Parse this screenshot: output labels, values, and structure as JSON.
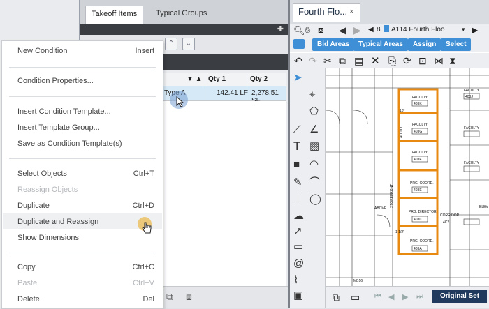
{
  "left_panel": {
    "tabs": [
      {
        "label": "Takeoff Items"
      },
      {
        "label": "Typical Groups"
      }
    ],
    "pin_icon": "pin-icon",
    "grid": {
      "columns": [
        "Qty 1",
        "Qty 2"
      ],
      "row": {
        "name": "Type A",
        "qty1": "142.41 LF",
        "qty2": "2,278.51 SF"
      }
    }
  },
  "context_menu": {
    "items": [
      {
        "label": "New Condition",
        "shortcut": "Insert",
        "enabled": true
      },
      {
        "label": "Condition Properties...",
        "shortcut": "",
        "enabled": true
      },
      {
        "label": "Insert Condition Template...",
        "shortcut": "",
        "enabled": true
      },
      {
        "label": "Insert Template Group...",
        "shortcut": "",
        "enabled": true
      },
      {
        "label": "Save as Condition Template(s)",
        "shortcut": "",
        "enabled": true
      },
      {
        "label": "Select Objects",
        "shortcut": "Ctrl+T",
        "enabled": true
      },
      {
        "label": "Reassign Objects",
        "shortcut": "",
        "enabled": false
      },
      {
        "label": "Duplicate",
        "shortcut": "Ctrl+D",
        "enabled": true
      },
      {
        "label": "Duplicate and Reassign",
        "shortcut": "",
        "enabled": true
      },
      {
        "label": "Show Dimensions",
        "shortcut": "",
        "enabled": true
      },
      {
        "label": "Copy",
        "shortcut": "Ctrl+C",
        "enabled": true
      },
      {
        "label": "Paste",
        "shortcut": "Ctrl+V",
        "enabled": false
      },
      {
        "label": "Delete",
        "shortcut": "Del",
        "enabled": true
      }
    ]
  },
  "right_window": {
    "tab_title": "Fourth Flo...",
    "close": "×",
    "page_number": "8",
    "sheet": "A114 Fourth Floo",
    "area_buttons": [
      "Bid Areas",
      "Typical Areas",
      "Assign",
      "Select"
    ],
    "original_set": "Original Set",
    "accent": "#3f8fd6",
    "highlight": "#f39c12"
  },
  "drawing": {
    "labels": [
      "FACULTY",
      "403K",
      "403J",
      "403G",
      "403F",
      "403E",
      "403C",
      "403A",
      "PRG. COORD.",
      "PRG. DIRECTOR",
      "AUDIO",
      "CORRIDOR",
      "STOREFRONT",
      "ABOVE",
      "MB16",
      "4C2",
      "ELEV",
      "10\"",
      "1 1/2\""
    ]
  }
}
